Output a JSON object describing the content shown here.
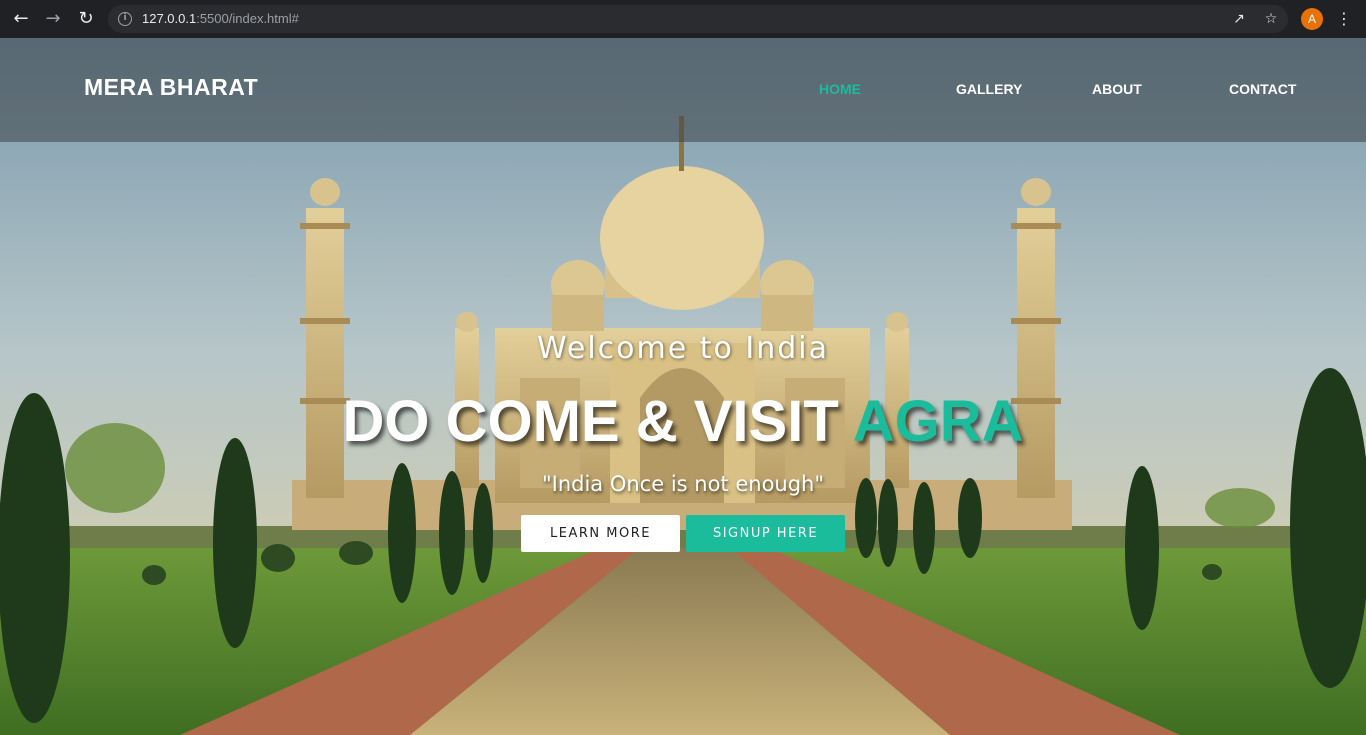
{
  "browser": {
    "url_host": "127.0.0.1",
    "url_rest": ":5500/index.html#",
    "avatar_letter": "A",
    "icons": [
      "back-icon",
      "forward-icon",
      "reload-icon",
      "info-icon",
      "share-icon",
      "star-icon",
      "menu-icon"
    ]
  },
  "site": {
    "brand": "MERA BHARAT",
    "nav": [
      {
        "label": "HOME",
        "active": true
      },
      {
        "label": "GALLERY",
        "active": false
      },
      {
        "label": "ABOUT",
        "active": false
      },
      {
        "label": "CONTACT",
        "active": false
      }
    ]
  },
  "hero": {
    "welcome": "Welcome to India",
    "headline_main": "DO COME & VISIT ",
    "headline_accent": "AGRA",
    "tagline": "\"India Once is not enough\"",
    "learn_more": "LEARN MORE",
    "signup": "SIGNUP HERE"
  },
  "colors": {
    "accent": "#1abc9c",
    "chrome_bg": "#202124",
    "avatar": "#e8710a"
  }
}
